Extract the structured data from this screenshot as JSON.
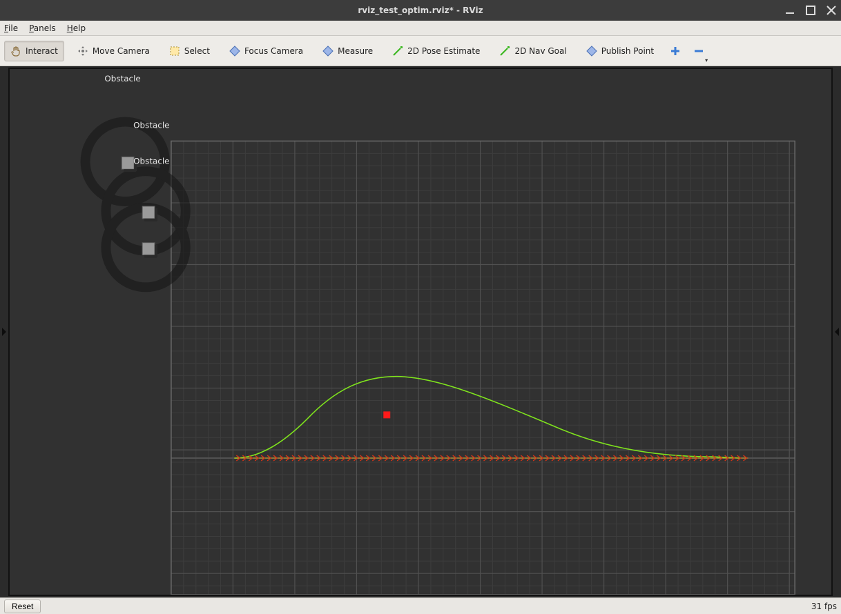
{
  "window": {
    "title": "rviz_test_optim.rviz* - RViz"
  },
  "menubar": {
    "file": "File",
    "panels": "Panels",
    "help": "Help"
  },
  "toolbar": {
    "interact": "Interact",
    "move_camera": "Move Camera",
    "select": "Select",
    "focus_camera": "Focus Camera",
    "measure": "Measure",
    "pose_estimate": "2D Pose Estimate",
    "nav_goal": "2D Nav Goal",
    "publish_point": "Publish Point"
  },
  "scene": {
    "labels": {
      "obstacle1": "Obstacle",
      "obstacle2": "Obstacle",
      "obstacle3": "Obstacle"
    },
    "colors": {
      "grid_major": "#515151",
      "grid_minor": "#3d3d3d",
      "path_green": "#7fe31d",
      "arrow_red": "#d43418",
      "arrow_yellow": "#caa31f",
      "marker_red": "#ff1a1a"
    }
  },
  "status": {
    "reset": "Reset",
    "fps": "31 fps"
  }
}
